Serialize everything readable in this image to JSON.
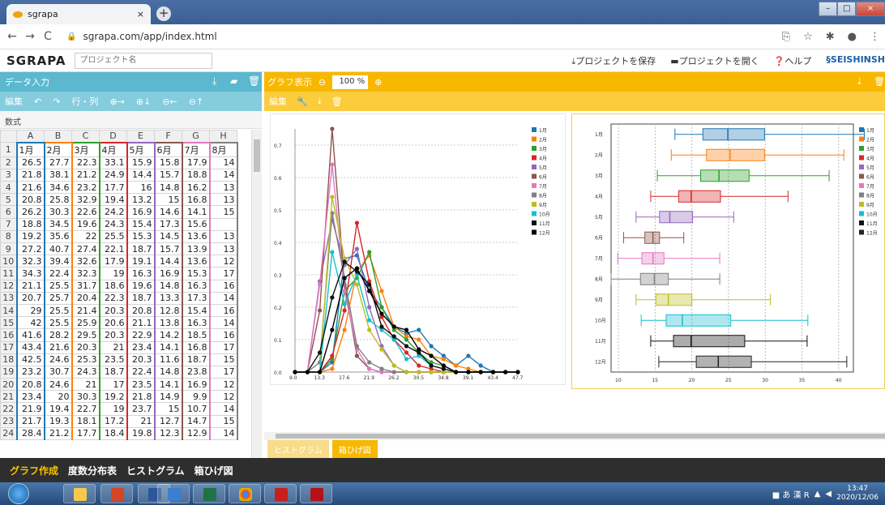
{
  "browser": {
    "tab_title": "sgrapa",
    "new_tab": "+",
    "url": "sgrapa.com/app/index.html"
  },
  "app": {
    "logo": "SGRAPA",
    "project_placeholder": "プロジェクト名",
    "save_project": "プロジェクトを保存",
    "open_project": "プロジェクトを開く",
    "help": "ヘルプ",
    "brand": "SEISHINSH"
  },
  "data_panel": {
    "title": "データ入力",
    "edit_label": "編集",
    "rowcol_label": "行・列",
    "formula_label": "数式"
  },
  "sheet": {
    "columns": [
      "A",
      "B",
      "C",
      "D",
      "E",
      "F",
      "G",
      "H"
    ],
    "header_row": [
      "1月",
      "2月",
      "3月",
      "4月",
      "5月",
      "6月",
      "7月",
      "8月"
    ],
    "rows": [
      [
        "26.5",
        "27.7",
        "22.3",
        "33.1",
        "15.9",
        "15.8",
        "17.9",
        "14"
      ],
      [
        "21.8",
        "38.1",
        "21.2",
        "24.9",
        "14.4",
        "15.7",
        "18.8",
        "14"
      ],
      [
        "21.6",
        "34.6",
        "23.2",
        "17.7",
        "16",
        "14.8",
        "16.2",
        "13"
      ],
      [
        "20.8",
        "25.8",
        "32.9",
        "19.4",
        "13.2",
        "15",
        "16.8",
        "13"
      ],
      [
        "26.2",
        "30.3",
        "22.6",
        "24.2",
        "16.9",
        "14.6",
        "14.1",
        "15"
      ],
      [
        "18.8",
        "34.5",
        "19.6",
        "24.3",
        "15.4",
        "17.3",
        "15.6",
        ""
      ],
      [
        "19.2",
        "35.6",
        "22",
        "25.5",
        "15.3",
        "14.5",
        "13.6",
        "13"
      ],
      [
        "27.2",
        "40.7",
        "27.4",
        "22.1",
        "18.7",
        "15.7",
        "13.9",
        "13"
      ],
      [
        "32.3",
        "39.4",
        "32.6",
        "17.9",
        "19.1",
        "14.4",
        "13.6",
        "12"
      ],
      [
        "34.3",
        "22.4",
        "32.3",
        "19",
        "16.3",
        "16.9",
        "15.3",
        "17"
      ],
      [
        "21.1",
        "25.5",
        "31.7",
        "18.6",
        "19.6",
        "14.8",
        "16.3",
        "16"
      ],
      [
        "20.7",
        "25.7",
        "20.4",
        "22.3",
        "18.7",
        "13.3",
        "17.3",
        "14"
      ],
      [
        "29",
        "25.5",
        "21.4",
        "20.3",
        "20.8",
        "12.8",
        "15.4",
        "16"
      ],
      [
        "42",
        "25.5",
        "25.9",
        "20.6",
        "21.1",
        "13.8",
        "16.3",
        "14"
      ],
      [
        "41.6",
        "28.2",
        "29.5",
        "20.3",
        "22.9",
        "14.2",
        "18.5",
        "16"
      ],
      [
        "43.4",
        "21.6",
        "20.3",
        "21",
        "23.4",
        "14.1",
        "16.8",
        "17"
      ],
      [
        "42.5",
        "24.6",
        "25.3",
        "23.5",
        "20.3",
        "11.6",
        "18.7",
        "15"
      ],
      [
        "23.2",
        "30.7",
        "24.3",
        "18.7",
        "22.4",
        "14.8",
        "23.8",
        "17"
      ],
      [
        "20.8",
        "24.6",
        "21",
        "17",
        "23.5",
        "14.1",
        "16.9",
        "12"
      ],
      [
        "23.4",
        "20",
        "30.3",
        "19.2",
        "21.8",
        "14.9",
        "9.9",
        "12"
      ],
      [
        "21.9",
        "19.4",
        "22.7",
        "19",
        "23.7",
        "15",
        "10.7",
        "14"
      ],
      [
        "21.7",
        "19.3",
        "18.1",
        "17.2",
        "21",
        "12.7",
        "14.7",
        "15"
      ],
      [
        "28.4",
        "21.2",
        "17.7",
        "18.4",
        "19.8",
        "12.3",
        "12.9",
        "14"
      ]
    ],
    "col_colors": [
      "#1f77b4",
      "#ff7f0e",
      "#2ca02c",
      "#d62728",
      "#9467bd",
      "#8c564b",
      "#e377c2",
      "#7f7f7f"
    ]
  },
  "graph_panel": {
    "title": "グラフ表示",
    "zoom": "100 %",
    "edit_label": "編集",
    "tabs": [
      "ヒストグラム",
      "箱ひげ図"
    ]
  },
  "bottom_nav": [
    "グラフ作成",
    "度数分布表",
    "ヒストグラム",
    "箱ひげ図"
  ],
  "taskbar": {
    "time": "13:47",
    "date": "2020/12/06"
  },
  "chart_data": [
    {
      "type": "line",
      "x": [
        9.0,
        11.15,
        13.3,
        15.45,
        17.6,
        19.75,
        21.9,
        24.05,
        26.2,
        28.35,
        30.5,
        32.65,
        34.8,
        36.95,
        39.1,
        41.25,
        43.4,
        45.55,
        47.7
      ],
      "x_tick_labels": [
        "9.0",
        "13.3",
        "17.6",
        "21.9",
        "26.2",
        "30.5",
        "34.8",
        "39.1",
        "43.4",
        "47.7"
      ],
      "ylim": [
        0,
        0.75
      ],
      "y_ticks": [
        "0.0",
        "0.1",
        "0.2",
        "0.3",
        "0.4",
        "0.5",
        "0.6",
        "0.7"
      ],
      "series": [
        {
          "name": "1月",
          "color": "#1f77b4",
          "values": [
            0,
            0,
            0,
            0.03,
            0.35,
            0.36,
            0.25,
            0.2,
            0.14,
            0.12,
            0.13,
            0.08,
            0.05,
            0.02,
            0.05,
            0.02,
            0,
            0,
            0
          ]
        },
        {
          "name": "2月",
          "color": "#ff7f0e",
          "values": [
            0,
            0,
            0,
            0.01,
            0.13,
            0.31,
            0.36,
            0.25,
            0.14,
            0.11,
            0.1,
            0.05,
            0.04,
            0.02,
            0.01,
            0,
            0,
            0,
            0
          ]
        },
        {
          "name": "3月",
          "color": "#2ca02c",
          "values": [
            0,
            0,
            0,
            0.04,
            0.25,
            0.29,
            0.37,
            0.2,
            0.13,
            0.1,
            0.06,
            0.03,
            0.02,
            0,
            0,
            0,
            0,
            0,
            0
          ]
        },
        {
          "name": "4月",
          "color": "#d62728",
          "values": [
            0,
            0,
            0,
            0.05,
            0.19,
            0.46,
            0.28,
            0.17,
            0.1,
            0.06,
            0.02,
            0.01,
            0,
            0,
            0,
            0,
            0,
            0,
            0
          ]
        },
        {
          "name": "5月",
          "color": "#9467bd",
          "values": [
            0,
            0,
            0.28,
            0.47,
            0.33,
            0.38,
            0.2,
            0.08,
            0.02,
            0,
            0,
            0,
            0,
            0,
            0,
            0,
            0,
            0,
            0
          ]
        },
        {
          "name": "6月",
          "color": "#8c564b",
          "values": [
            0,
            0,
            0.19,
            0.75,
            0.27,
            0.05,
            0.01,
            0,
            0,
            0,
            0,
            0,
            0,
            0,
            0,
            0,
            0,
            0,
            0
          ]
        },
        {
          "name": "7月",
          "color": "#e377c2",
          "values": [
            0,
            0,
            0.27,
            0.64,
            0.25,
            0.07,
            0.01,
            0,
            0,
            0,
            0,
            0,
            0,
            0,
            0,
            0,
            0,
            0,
            0
          ]
        },
        {
          "name": "8月",
          "color": "#7f7f7f",
          "values": [
            0,
            0,
            0.03,
            0.49,
            0.29,
            0.08,
            0.03,
            0.01,
            0,
            0,
            0,
            0,
            0,
            0,
            0,
            0,
            0,
            0,
            0
          ]
        },
        {
          "name": "9月",
          "color": "#bcbd22",
          "values": [
            0,
            0,
            0,
            0.54,
            0.35,
            0.27,
            0.13,
            0.07,
            0.02,
            0,
            0,
            0,
            0,
            0,
            0,
            0,
            0,
            0,
            0
          ]
        },
        {
          "name": "10月",
          "color": "#17becf",
          "values": [
            0,
            0,
            0,
            0.37,
            0.21,
            0.3,
            0.16,
            0.13,
            0.1,
            0.04,
            0.05,
            0.02,
            0.01,
            0,
            0,
            0,
            0,
            0,
            0
          ]
        },
        {
          "name": "11月",
          "color": "#111111",
          "values": [
            0,
            0,
            0.06,
            0.23,
            0.34,
            0.31,
            0.27,
            0.14,
            0.11,
            0.08,
            0.06,
            0.02,
            0.01,
            0,
            0,
            0,
            0,
            0,
            0
          ]
        },
        {
          "name": "12月",
          "color": "#000000",
          "values": [
            0,
            0,
            0,
            0.13,
            0.29,
            0.32,
            0.25,
            0.18,
            0.14,
            0.13,
            0.07,
            0.05,
            0.02,
            0,
            0,
            0,
            0,
            0,
            0
          ]
        }
      ]
    },
    {
      "type": "box",
      "categories": [
        "1月",
        "2月",
        "3月",
        "4月",
        "5月",
        "6月",
        "7月",
        "8月",
        "9月",
        "10月",
        "11月",
        "12月"
      ],
      "xlim": [
        9,
        42
      ],
      "x_ticks": [
        "10",
        "15",
        "20",
        "25",
        "30",
        "35",
        "40"
      ],
      "stats": [
        {
          "min": 17.7,
          "q1": 21.5,
          "median": 24.9,
          "q3": 29.9,
          "max": 43.5,
          "color": "#1f77b4"
        },
        {
          "min": 17.2,
          "q1": 22.0,
          "median": 25.2,
          "q3": 29.9,
          "max": 40.7,
          "color": "#ff7f0e"
        },
        {
          "min": 15.3,
          "q1": 21.2,
          "median": 23.7,
          "q3": 27.8,
          "max": 38.7,
          "color": "#2ca02c"
        },
        {
          "min": 14.4,
          "q1": 18.2,
          "median": 19.9,
          "q3": 23.9,
          "max": 33.1,
          "color": "#d62728"
        },
        {
          "min": 12.4,
          "q1": 15.6,
          "median": 17.0,
          "q3": 20.1,
          "max": 25.7,
          "color": "#9467bd"
        },
        {
          "min": 10.7,
          "q1": 13.6,
          "median": 14.7,
          "q3": 15.6,
          "max": 18.9,
          "color": "#8c564b"
        },
        {
          "min": 9.9,
          "q1": 13.2,
          "median": 14.7,
          "q3": 16.2,
          "max": 23.8,
          "color": "#e377c2"
        },
        {
          "min": 9.0,
          "q1": 13.0,
          "median": 14.9,
          "q3": 16.8,
          "max": 23.8,
          "color": "#7f7f7f"
        },
        {
          "min": 12.4,
          "q1": 15.1,
          "median": 16.8,
          "q3": 20.0,
          "max": 30.7,
          "color": "#bcbd22"
        },
        {
          "min": 13.1,
          "q1": 16.5,
          "median": 18.7,
          "q3": 25.3,
          "max": 35.8,
          "color": "#17becf"
        },
        {
          "min": 14.4,
          "q1": 17.5,
          "median": 19.9,
          "q3": 27.2,
          "max": 35.7,
          "color": "#111111"
        },
        {
          "min": 15.5,
          "q1": 20.6,
          "median": 23.6,
          "q3": 28.1,
          "max": 41.1,
          "color": "#222222"
        }
      ]
    }
  ]
}
